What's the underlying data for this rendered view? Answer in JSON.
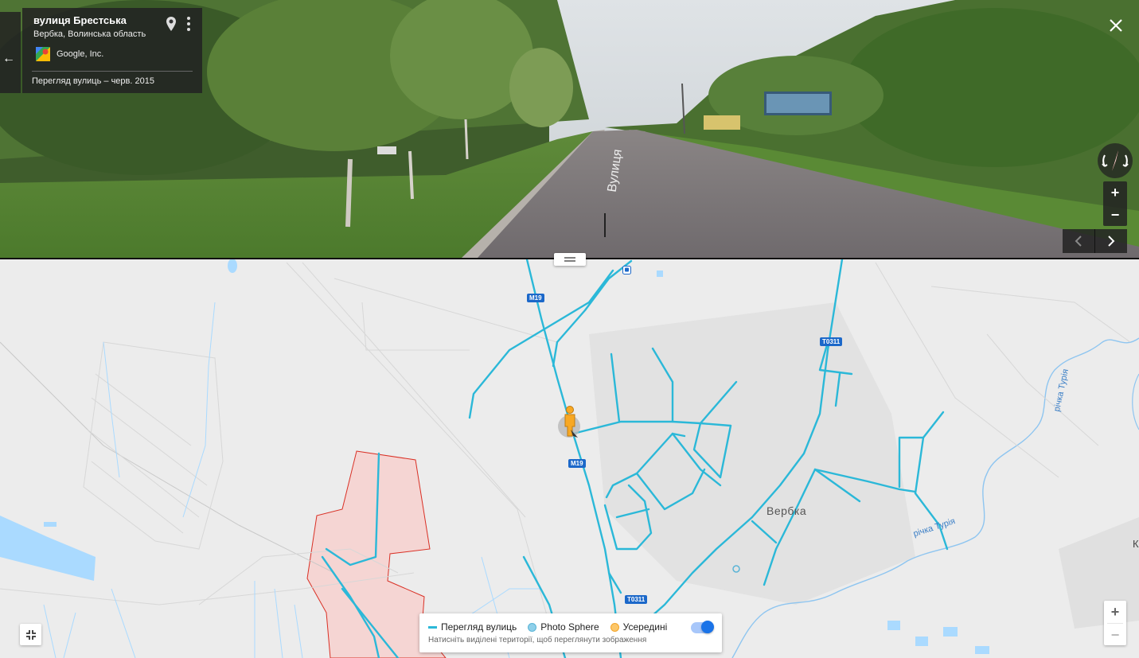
{
  "info_card": {
    "title": "вулиця Брестська",
    "subtitle": "Вербка, Волинська область",
    "author": "Google, Inc.",
    "date": "Перегляд вулиць – черв. 2015"
  },
  "panorama_controls": {
    "zoom_in": "+",
    "zoom_out": "−"
  },
  "map": {
    "road_labels": [
      "M19",
      "M19",
      "T0311",
      "T0311"
    ],
    "place_label": "Вербка",
    "river_label_1": "річка Турія",
    "river_label_2": "річка Турія",
    "edge_letter": "К",
    "zoom_in": "+",
    "zoom_out": "−"
  },
  "legend": {
    "street_view": "Перегляд вулиць",
    "photo_sphere": "Photo Sphere",
    "indoor": "Усередині",
    "hint": "Натисніть виділені території, щоб переглянути зображення",
    "toggle_on": true
  },
  "colors": {
    "street_view_line": "#2bb8d8",
    "photo_sphere": "#5ab4d6",
    "indoor": "#f4a52a",
    "toggle": "#1a73e8",
    "road_shield": "#1c68c9"
  },
  "icons": {
    "back": "arrow-left-icon",
    "pin": "map-pin-icon",
    "more": "more-vert-icon",
    "close": "close-icon",
    "compass": "compass-icon",
    "prev": "chevron-left-icon",
    "next": "chevron-right-icon",
    "collapse": "collapse-icon",
    "pegman": "pegman-icon"
  }
}
